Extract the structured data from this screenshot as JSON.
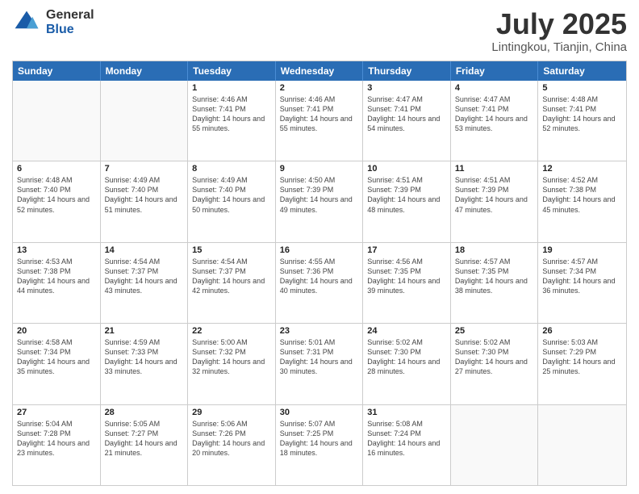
{
  "header": {
    "logo": {
      "general": "General",
      "blue": "Blue"
    },
    "title": "July 2025",
    "location": "Lintingkou, Tianjin, China"
  },
  "calendar": {
    "days": [
      "Sunday",
      "Monday",
      "Tuesday",
      "Wednesday",
      "Thursday",
      "Friday",
      "Saturday"
    ],
    "rows": [
      [
        {
          "day": "",
          "detail": ""
        },
        {
          "day": "",
          "detail": ""
        },
        {
          "day": "1",
          "detail": "Sunrise: 4:46 AM\nSunset: 7:41 PM\nDaylight: 14 hours and 55 minutes."
        },
        {
          "day": "2",
          "detail": "Sunrise: 4:46 AM\nSunset: 7:41 PM\nDaylight: 14 hours and 55 minutes."
        },
        {
          "day": "3",
          "detail": "Sunrise: 4:47 AM\nSunset: 7:41 PM\nDaylight: 14 hours and 54 minutes."
        },
        {
          "day": "4",
          "detail": "Sunrise: 4:47 AM\nSunset: 7:41 PM\nDaylight: 14 hours and 53 minutes."
        },
        {
          "day": "5",
          "detail": "Sunrise: 4:48 AM\nSunset: 7:41 PM\nDaylight: 14 hours and 52 minutes."
        }
      ],
      [
        {
          "day": "6",
          "detail": "Sunrise: 4:48 AM\nSunset: 7:40 PM\nDaylight: 14 hours and 52 minutes."
        },
        {
          "day": "7",
          "detail": "Sunrise: 4:49 AM\nSunset: 7:40 PM\nDaylight: 14 hours and 51 minutes."
        },
        {
          "day": "8",
          "detail": "Sunrise: 4:49 AM\nSunset: 7:40 PM\nDaylight: 14 hours and 50 minutes."
        },
        {
          "day": "9",
          "detail": "Sunrise: 4:50 AM\nSunset: 7:39 PM\nDaylight: 14 hours and 49 minutes."
        },
        {
          "day": "10",
          "detail": "Sunrise: 4:51 AM\nSunset: 7:39 PM\nDaylight: 14 hours and 48 minutes."
        },
        {
          "day": "11",
          "detail": "Sunrise: 4:51 AM\nSunset: 7:39 PM\nDaylight: 14 hours and 47 minutes."
        },
        {
          "day": "12",
          "detail": "Sunrise: 4:52 AM\nSunset: 7:38 PM\nDaylight: 14 hours and 45 minutes."
        }
      ],
      [
        {
          "day": "13",
          "detail": "Sunrise: 4:53 AM\nSunset: 7:38 PM\nDaylight: 14 hours and 44 minutes."
        },
        {
          "day": "14",
          "detail": "Sunrise: 4:54 AM\nSunset: 7:37 PM\nDaylight: 14 hours and 43 minutes."
        },
        {
          "day": "15",
          "detail": "Sunrise: 4:54 AM\nSunset: 7:37 PM\nDaylight: 14 hours and 42 minutes."
        },
        {
          "day": "16",
          "detail": "Sunrise: 4:55 AM\nSunset: 7:36 PM\nDaylight: 14 hours and 40 minutes."
        },
        {
          "day": "17",
          "detail": "Sunrise: 4:56 AM\nSunset: 7:35 PM\nDaylight: 14 hours and 39 minutes."
        },
        {
          "day": "18",
          "detail": "Sunrise: 4:57 AM\nSunset: 7:35 PM\nDaylight: 14 hours and 38 minutes."
        },
        {
          "day": "19",
          "detail": "Sunrise: 4:57 AM\nSunset: 7:34 PM\nDaylight: 14 hours and 36 minutes."
        }
      ],
      [
        {
          "day": "20",
          "detail": "Sunrise: 4:58 AM\nSunset: 7:34 PM\nDaylight: 14 hours and 35 minutes."
        },
        {
          "day": "21",
          "detail": "Sunrise: 4:59 AM\nSunset: 7:33 PM\nDaylight: 14 hours and 33 minutes."
        },
        {
          "day": "22",
          "detail": "Sunrise: 5:00 AM\nSunset: 7:32 PM\nDaylight: 14 hours and 32 minutes."
        },
        {
          "day": "23",
          "detail": "Sunrise: 5:01 AM\nSunset: 7:31 PM\nDaylight: 14 hours and 30 minutes."
        },
        {
          "day": "24",
          "detail": "Sunrise: 5:02 AM\nSunset: 7:30 PM\nDaylight: 14 hours and 28 minutes."
        },
        {
          "day": "25",
          "detail": "Sunrise: 5:02 AM\nSunset: 7:30 PM\nDaylight: 14 hours and 27 minutes."
        },
        {
          "day": "26",
          "detail": "Sunrise: 5:03 AM\nSunset: 7:29 PM\nDaylight: 14 hours and 25 minutes."
        }
      ],
      [
        {
          "day": "27",
          "detail": "Sunrise: 5:04 AM\nSunset: 7:28 PM\nDaylight: 14 hours and 23 minutes."
        },
        {
          "day": "28",
          "detail": "Sunrise: 5:05 AM\nSunset: 7:27 PM\nDaylight: 14 hours and 21 minutes."
        },
        {
          "day": "29",
          "detail": "Sunrise: 5:06 AM\nSunset: 7:26 PM\nDaylight: 14 hours and 20 minutes."
        },
        {
          "day": "30",
          "detail": "Sunrise: 5:07 AM\nSunset: 7:25 PM\nDaylight: 14 hours and 18 minutes."
        },
        {
          "day": "31",
          "detail": "Sunrise: 5:08 AM\nSunset: 7:24 PM\nDaylight: 14 hours and 16 minutes."
        },
        {
          "day": "",
          "detail": ""
        },
        {
          "day": "",
          "detail": ""
        }
      ]
    ]
  }
}
